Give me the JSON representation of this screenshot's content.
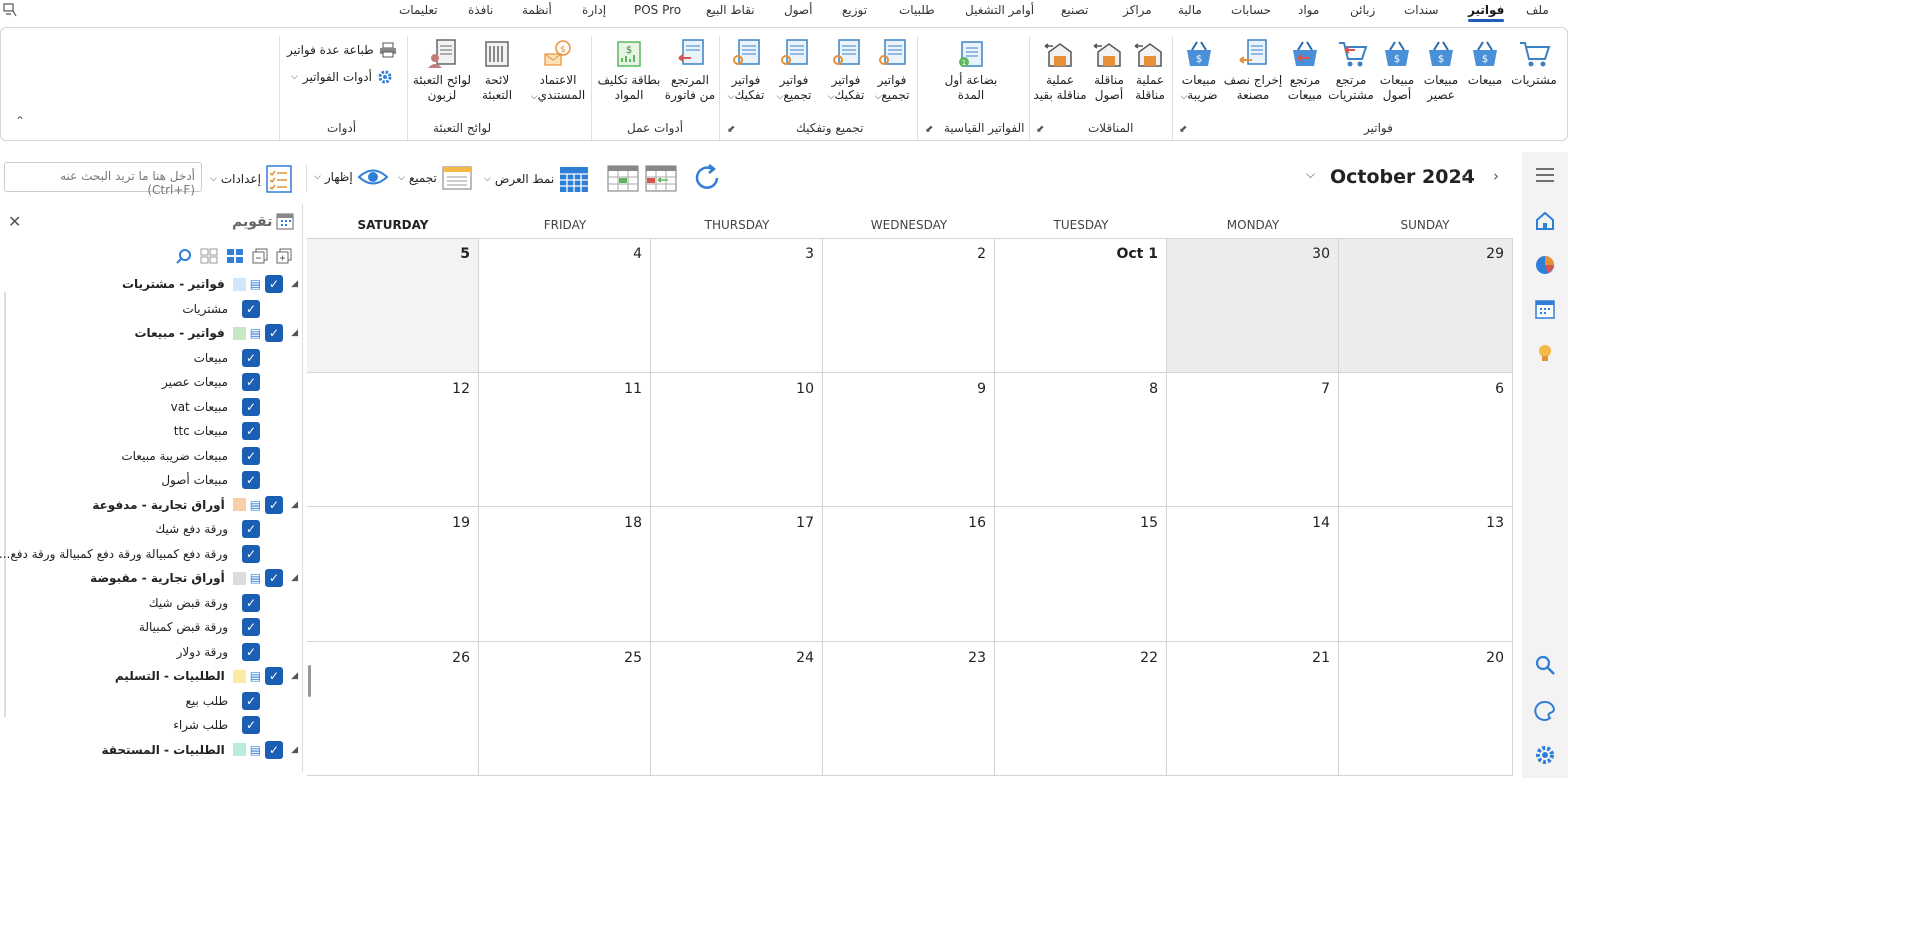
{
  "menu": [
    "ملف",
    "فواتير",
    "سندات",
    "زبائن",
    "مواد",
    "حسابات",
    "مالية",
    "مراكز",
    "تصنيع",
    "أوامر التشغيل",
    "طلبيات",
    "توزيع",
    "أصول",
    "نقاط البيع",
    "POS Pro",
    "إدارة",
    "أنظمة",
    "نافذة",
    "تعليمات"
  ],
  "menu_active": "فواتير",
  "ribbon": {
    "invoices": {
      "label": "فواتير",
      "buttons": [
        [
          "مشتريات"
        ],
        [
          "مبيعات"
        ],
        [
          "مبيعات",
          "عصير"
        ],
        [
          "مبيعات",
          "أصول"
        ],
        [
          "مرتجع",
          "مشتريات"
        ],
        [
          "مرتجع",
          "مبيعات"
        ],
        [
          "إخراج نصف",
          "مصنعة"
        ],
        [
          "مبيعات",
          "ضريبة"
        ]
      ]
    },
    "transfers": {
      "label": "المناقلات",
      "buttons": [
        [
          "عملية",
          "مناقلة"
        ],
        [
          "مناقلة",
          "أصول"
        ],
        [
          "عملية",
          "مناقلة بقيد"
        ]
      ]
    },
    "standard": {
      "label": "الفواتير القياسية",
      "buttons": [
        [
          "بضاعة أول",
          "المدة"
        ]
      ]
    },
    "assembly": {
      "label": "تجميع وتفكيك",
      "buttons": [
        [
          "فواتير",
          "تجميع"
        ],
        [
          "فواتير",
          "تفكيك"
        ],
        [
          "فواتير",
          "تجميع"
        ],
        [
          "فواتير",
          "تفكيك"
        ]
      ]
    },
    "work_tools": {
      "label": "أدوات عمل",
      "buttons": [
        [
          "المرتجع",
          "من فاتورة"
        ],
        [
          "بطاقة تكليف",
          "المواد"
        ],
        [
          "الاعتماد",
          "المستندي"
        ]
      ]
    },
    "packing": {
      "label": "لوائح التعبئة",
      "buttons": [
        [
          "لائحة",
          "التعبئة"
        ],
        [
          "لوائح التعبئة",
          "لزبون"
        ]
      ]
    },
    "tools": {
      "label": "أدوات",
      "print_many": "طباعة عدة فواتير",
      "invoice_tools": "أدوات الفواتير"
    }
  },
  "toolbar": {
    "search_placeholder": "أدخل هنا ما تريد البحث عنه (Ctrl+F)",
    "settings": "إعدادات",
    "show": "إظهار",
    "group": "تجميع",
    "view_mode": "نمط العرض",
    "month_title": "October 2024"
  },
  "sidebar": {
    "title": "تقويم",
    "rows": [
      {
        "type": "hdr",
        "label": "فواتير - مشتريات",
        "color": "#cfe6fb"
      },
      {
        "type": "item",
        "label": "مشتريات"
      },
      {
        "type": "hdr",
        "label": "فواتير - مبيعات",
        "color": "#c6e9c4"
      },
      {
        "type": "item",
        "label": "مبيعات"
      },
      {
        "type": "item",
        "label": "مبيعات عصير"
      },
      {
        "type": "item",
        "label": "مبيعات vat"
      },
      {
        "type": "item",
        "label": "مبيعات ttc"
      },
      {
        "type": "item",
        "label": "مبيعات ضريبة مبيعات"
      },
      {
        "type": "item",
        "label": "مبيعات أصول"
      },
      {
        "type": "hdr",
        "label": "أوراق تجارية - مدفوعة",
        "color": "#f9cfa8"
      },
      {
        "type": "item",
        "label": "ورقة دفع شيك"
      },
      {
        "type": "item",
        "label": "ورقة دفع كمبيالة ورقة دفع كمبيالة ورقة دفع..."
      },
      {
        "type": "hdr",
        "label": "أوراق تجارية - مقبوضة",
        "color": "#dcdcdc"
      },
      {
        "type": "item",
        "label": "ورقة قبض شيك"
      },
      {
        "type": "item",
        "label": "ورقة قبض كمبيالة"
      },
      {
        "type": "item",
        "label": "ورقة دولار"
      },
      {
        "type": "hdr",
        "label": "الطلبيات - التسليم",
        "color": "#fbeaa6"
      },
      {
        "type": "item",
        "label": "طلب بيع"
      },
      {
        "type": "item",
        "label": "طلب شراء"
      },
      {
        "type": "hdr",
        "label": "الطلبيات - المستحقة",
        "color": "#b9ecd9"
      }
    ]
  },
  "calendar": {
    "days": [
      "SATURDAY",
      "FRIDAY",
      "THURSDAY",
      "WEDNESDAY",
      "TUESDAY",
      "MONDAY",
      "SUNDAY"
    ],
    "selected_day": "SATURDAY",
    "weeks": [
      [
        "5",
        "4",
        "3",
        "2",
        "Oct 1",
        "30",
        "29"
      ],
      [
        "12",
        "11",
        "10",
        "9",
        "8",
        "7",
        "6"
      ],
      [
        "19",
        "18",
        "17",
        "16",
        "15",
        "14",
        "13"
      ],
      [
        "26",
        "25",
        "24",
        "23",
        "22",
        "21",
        "20"
      ]
    ]
  }
}
